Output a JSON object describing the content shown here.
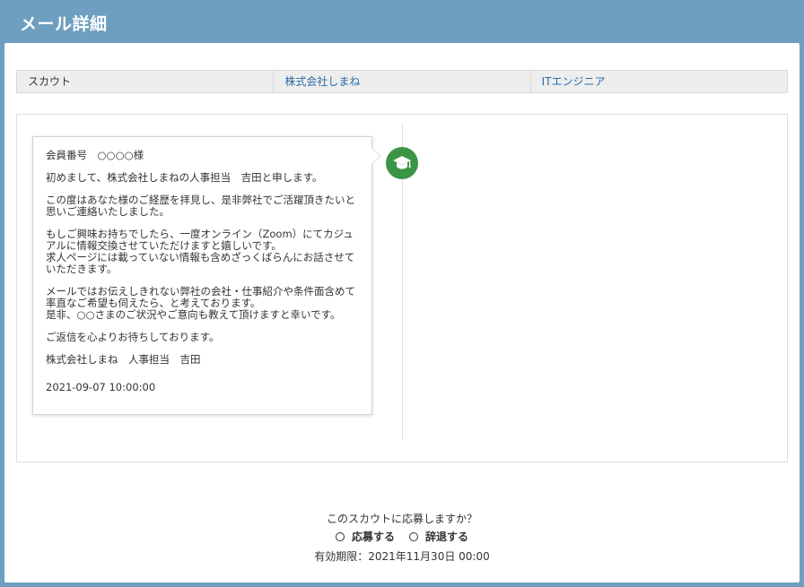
{
  "header": {
    "title": "メール詳細"
  },
  "info": {
    "type": "スカウト",
    "company": "株式会社しまね",
    "job": "ITエンジニア"
  },
  "message": {
    "icon": "graduation-cap-icon",
    "lines": [
      "会員番号　○○○○様",
      "初めまして、株式会社しまねの人事担当　吉田と申します。",
      "この度はあなた様のご経歴を拝見し、是非弊社でご活躍頂きたいと思いご連絡いたしました。",
      "もしご興味お持ちでしたら、一度オンライン（Zoom）にてカジュアルに情報交換させていただけますと嬉しいです。\n求人ページには載っていない情報も含めざっくばらんにお話させていただきます。",
      "メールではお伝えしきれない弊社の会社・仕事紹介や条件面含めて率直なご希望も伺えたら、と考えております。\n是非、○○さまのご状況やご意向も教えて頂けますと幸いです。",
      "ご返信を心よりお待ちしております。",
      "株式会社しまね　人事担当　吉田"
    ],
    "date": "2021-09-07 10:00:00"
  },
  "footer": {
    "question": "このスカウトに応募しますか？",
    "apply_label": "応募する",
    "decline_label": "辞退する",
    "deadline": "有効期限：2021年11月30日 00:00"
  },
  "colors": {
    "header_bg": "#6e9fc0",
    "link": "#2a6aa8",
    "avatar_bg": "#3c9446"
  }
}
